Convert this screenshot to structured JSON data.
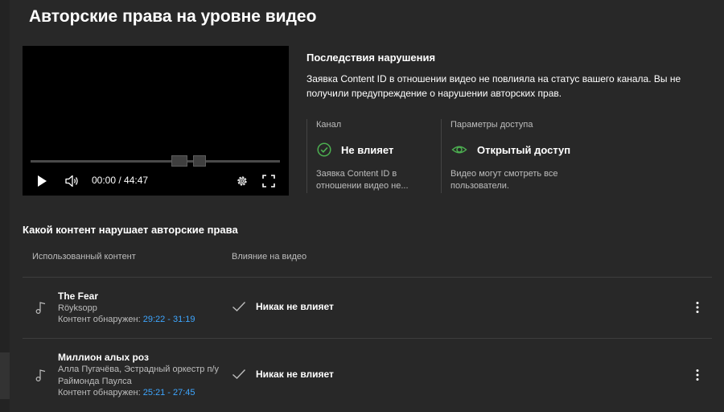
{
  "header": {
    "title": "Авторские права на уровне видео"
  },
  "player": {
    "time": "00:00 / 44:47"
  },
  "consequences": {
    "title": "Последствия нарушения",
    "text": "Заявка Content ID в отношении видео не повлияла на статус вашего канала. Вы не получили предупреждение о нарушении авторских прав.",
    "channel": {
      "label": "Канал",
      "status": "Не влияет",
      "description": "Заявка Content ID в отношении видео не..."
    },
    "access": {
      "label": "Параметры доступа",
      "status": "Открытый доступ",
      "description": "Видео могут смотреть все пользователи."
    }
  },
  "content": {
    "title": "Какой контент нарушает авторские права",
    "col_used": "Использованный контент",
    "col_impact": "Влияние на видео",
    "detected_label": "Контент обнаружен:",
    "items": [
      {
        "title": "The Fear",
        "artist": "Röyksopp",
        "detected_range": "29:22 - 31:19",
        "impact": "Никак не влияет"
      },
      {
        "title": "Миллион алых роз",
        "artist": "Алла Пугачёва, Эстрадный оркестр п/у Раймонда Паулса",
        "detected_range": "25:21 - 27:45",
        "impact": "Никак не влияет"
      }
    ]
  },
  "colors": {
    "background": "#282828",
    "accent_green": "#4caf50",
    "link_blue": "#3ea6ff",
    "muted_text": "#bdbdbd"
  },
  "icons": [
    "play-icon",
    "volume-icon",
    "gear-icon",
    "fullscreen-icon",
    "check-circle-icon",
    "eye-icon",
    "music-note-icon",
    "checkmark-icon",
    "more-vert-icon"
  ]
}
